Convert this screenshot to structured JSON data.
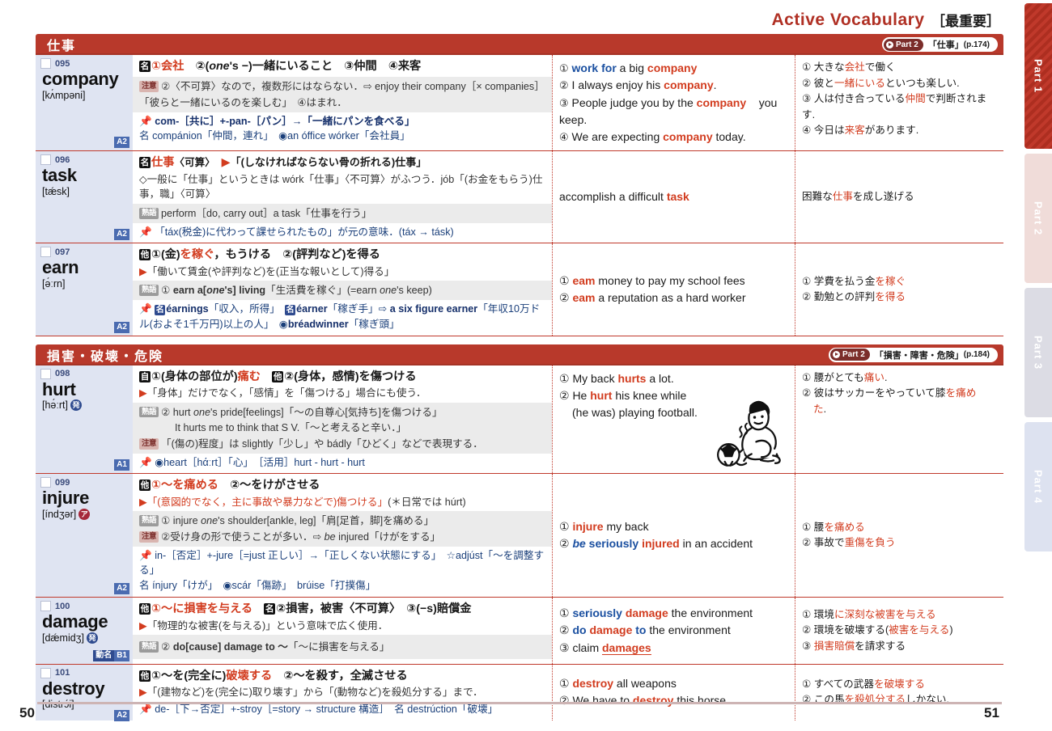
{
  "header": {
    "title": "Active Vocabulary",
    "subtitle": "［最重要］"
  },
  "side_tabs": [
    {
      "label": "Part 1",
      "active": true
    },
    {
      "label": "Part 2",
      "active": false
    },
    {
      "label": "Part 3",
      "active": false
    },
    {
      "label": "Part 4",
      "active": false
    }
  ],
  "footer": {
    "page_left": "50",
    "page_right": "51"
  },
  "colors": {
    "accent_red": "#b8392b",
    "headword_blue_panel": "#dfe4f2",
    "keyword_red": "#d23c1f",
    "collocation_blue": "#1a4fa0",
    "level_badge": "#4a6bb0"
  },
  "sections": [
    {
      "title": "仕事",
      "pill": {
        "part": "Part 2",
        "theme": "「仕事」",
        "page": "(p.174)"
      },
      "entries": [
        {
          "number": "095",
          "word": "company",
          "phonetic": "[kʌ́mpəni]",
          "marks": [],
          "level": "A2",
          "level_extra": "",
          "def_main_pos": "名",
          "def_main": "①会社　②(one's −)一緒にいること　③仲間　④来客",
          "note_tag": "注意",
          "note": "②〈不可算〉なので，複数形にはならない．⇨ enjoy their company［× companies］「彼らと一緒にいるのを楽しむ」　④はまれ．",
          "etym": "com-［共に］+-pan-［パン］→「一緒にパンを食べる」",
          "etym2": "名 compánion「仲間，連れ」　◉an óffice wórker「会社員」",
          "examples": [
            {
              "num": "①",
              "en": "work for a big company",
              "jp": "大きな会社で働く"
            },
            {
              "num": "②",
              "en": "I always enjoy his company.",
              "jp": "彼と一緒にいるといつも楽しい."
            },
            {
              "num": "③",
              "en": "People judge you by the company you keep.",
              "jp": "人は付き合っている仲間で判断されます."
            },
            {
              "num": "④",
              "en": "We are expecting company today.",
              "jp": "今日は来客があります."
            }
          ]
        },
        {
          "number": "096",
          "word": "task",
          "phonetic": "[tǽsk]",
          "marks": [],
          "level": "A2",
          "level_extra": "",
          "def_main_pos": "名",
          "def_main": "仕事〈可算〉　▶「(しなければならない骨の折れる)仕事」",
          "def_sub": "◇一般に「仕事」というときは wórk「仕事」〈不可算〉がふつう．jób「(お金をもらう)仕事，職」〈可算〉",
          "note_tag": "熟語",
          "note": "perform［do, carry out］a task「仕事を行う」",
          "etym": "「táx(税金)に代わって課せられたもの」が元の意味．(táx → tásk)",
          "etym2": "",
          "examples": [
            {
              "num": "",
              "en": "accomplish a difficult task",
              "jp": "困難な仕事を成し遂げる"
            }
          ]
        },
        {
          "number": "097",
          "word": "earn",
          "phonetic": "[ə́ːrn]",
          "marks": [],
          "level": "A2",
          "level_extra": "",
          "def_main_pos": "他",
          "def_main": "①(金)を稼ぐ，もうける　②(評判など)を得る",
          "def_sub": "▶「働いて賃金(や評判など)を(正当な報いとして)得る」",
          "note_tag": "熟語",
          "note": "① earn a［one's］living「生活費を稼ぐ」(=earn one's keep)",
          "etym": "名 éarnings「収入，所得」　名 éarner「稼ぎ手」⇨ a six figure earner「年収10万ドル(およそ1千万円)以上の人」　◉bréadwinner「稼ぎ頭」",
          "etym2": "",
          "examples": [
            {
              "num": "①",
              "en": "eam money to pay my school fees",
              "jp": "学費を払う金を稼ぐ"
            },
            {
              "num": "②",
              "en": "eam a reputation as a hard worker",
              "jp": "勤勉との評判を得る"
            }
          ]
        }
      ]
    },
    {
      "title": "損害・破壊・危険",
      "pill": {
        "part": "Part 2",
        "theme": "「損害・障害・危険」",
        "page": "(p.184)"
      },
      "entries": [
        {
          "number": "098",
          "word": "hurt",
          "phonetic": "[hə́ːrt]",
          "mark_blue": "発",
          "level": "A1",
          "level_extra": "",
          "def_main_pos": "自",
          "def_main": "①(身体の部位が)痛む　他②(身体，感情)を傷つける",
          "def_sub": "▶「身体」だけでなく，「感情」を「傷つける」場合にも使う．",
          "note_tag": "熟語",
          "note": "② hurt one's pride［feelings］「〜の自尊心［気持ち］を傷つける」",
          "note_b": "It hurts me to think that S V.「〜と考えると辛い．」",
          "note_tag2": "注意",
          "note2": "「(傷の)程度」は slightly「少し」や bádly「ひどく」などで表現する．",
          "etym": "◉heart［hάːrt］「心」　［活用］hurt - hurt - hurt",
          "etym2": "",
          "illustration": "boy-holding-knee-with-soccer-ball",
          "examples": [
            {
              "num": "①",
              "en": "My back hurts a lot.",
              "jp": "腰がとても痛い."
            },
            {
              "num": "②",
              "en": "He hurt his knee while (he was) playing football.",
              "jp": "彼はサッカーをやっていて膝を痛めた."
            }
          ]
        },
        {
          "number": "099",
          "word": "injure",
          "phonetic": "[índʒər]",
          "mark_red": "ア",
          "level": "A2",
          "level_extra": "",
          "def_main_pos": "他",
          "def_main": "①〜を痛める　②〜をけがさせる",
          "def_sub": "▶「(意図的でなく，主に事故や暴力などで)傷つける」(＊日常では húrt)",
          "note_tag": "熟語",
          "note": "① injure one's shoulder［ankle, leg］「肩［足首，脚］を痛める」",
          "note_tag2": "注意",
          "note2": "②受け身の形で使うことが多い．⇨ be injured「けがをする」",
          "etym": "in-［否定］+-jure［=just 正しい］→「正しくない状態にする」　☆adjúst「〜を調整する」",
          "etym2": "名 ínjury「けが」　◉scár「傷跡」　brúise「打撲傷」",
          "examples": [
            {
              "num": "①",
              "en": "injure my back",
              "jp": "腰を痛める"
            },
            {
              "num": "②",
              "en": "be seriously injured in an accident",
              "jp": "事故で重傷を負う"
            }
          ]
        },
        {
          "number": "100",
          "word": "damage",
          "phonetic": "[dǽmidʒ]",
          "mark_blue": "発",
          "level": "B1",
          "level_extra": "動名",
          "def_main_pos": "他",
          "def_main": "①〜に損害を与える　名②損害，被害〈不可算〉　③(−s)賠償金",
          "def_sub": "▶「物理的な被害(を与える)」という意味で広く使用．",
          "note_tag": "熟語",
          "note": "② do［cause］damage to 〜「〜に損害を与える」",
          "etym": "",
          "etym2": "",
          "examples": [
            {
              "num": "①",
              "en": "seriously damage the environment",
              "jp": "環境に深刻な被害を与える"
            },
            {
              "num": "②",
              "en": "do damage to the environment",
              "jp": "環境を破壊する(被害を与える)"
            },
            {
              "num": "③",
              "en": "claim damages",
              "jp": "損害賠償を請求する"
            }
          ]
        },
        {
          "number": "101",
          "word": "destroy",
          "phonetic": "[distrɔ́i]",
          "marks": [],
          "level": "A2",
          "level_extra": "",
          "def_main_pos": "他",
          "def_main": "①〜を(完全に)破壊する　②〜を殺す，全滅させる",
          "def_sub": "▶「(建物など)を(完全に)取り壊す」から「(動物など)を殺処分する」まで．",
          "note_tag": "",
          "note": "",
          "etym": "de-［下→否定］+-stroy［=story → structure 構造］　名 destrúction「破壊」",
          "etym2": "",
          "examples": [
            {
              "num": "①",
              "en": "destroy all weapons",
              "jp": "すべての武器を破壊する"
            },
            {
              "num": "②",
              "en": "We have to destroy this horse.",
              "jp": "この馬を殺処分するしかない."
            }
          ]
        }
      ]
    }
  ]
}
